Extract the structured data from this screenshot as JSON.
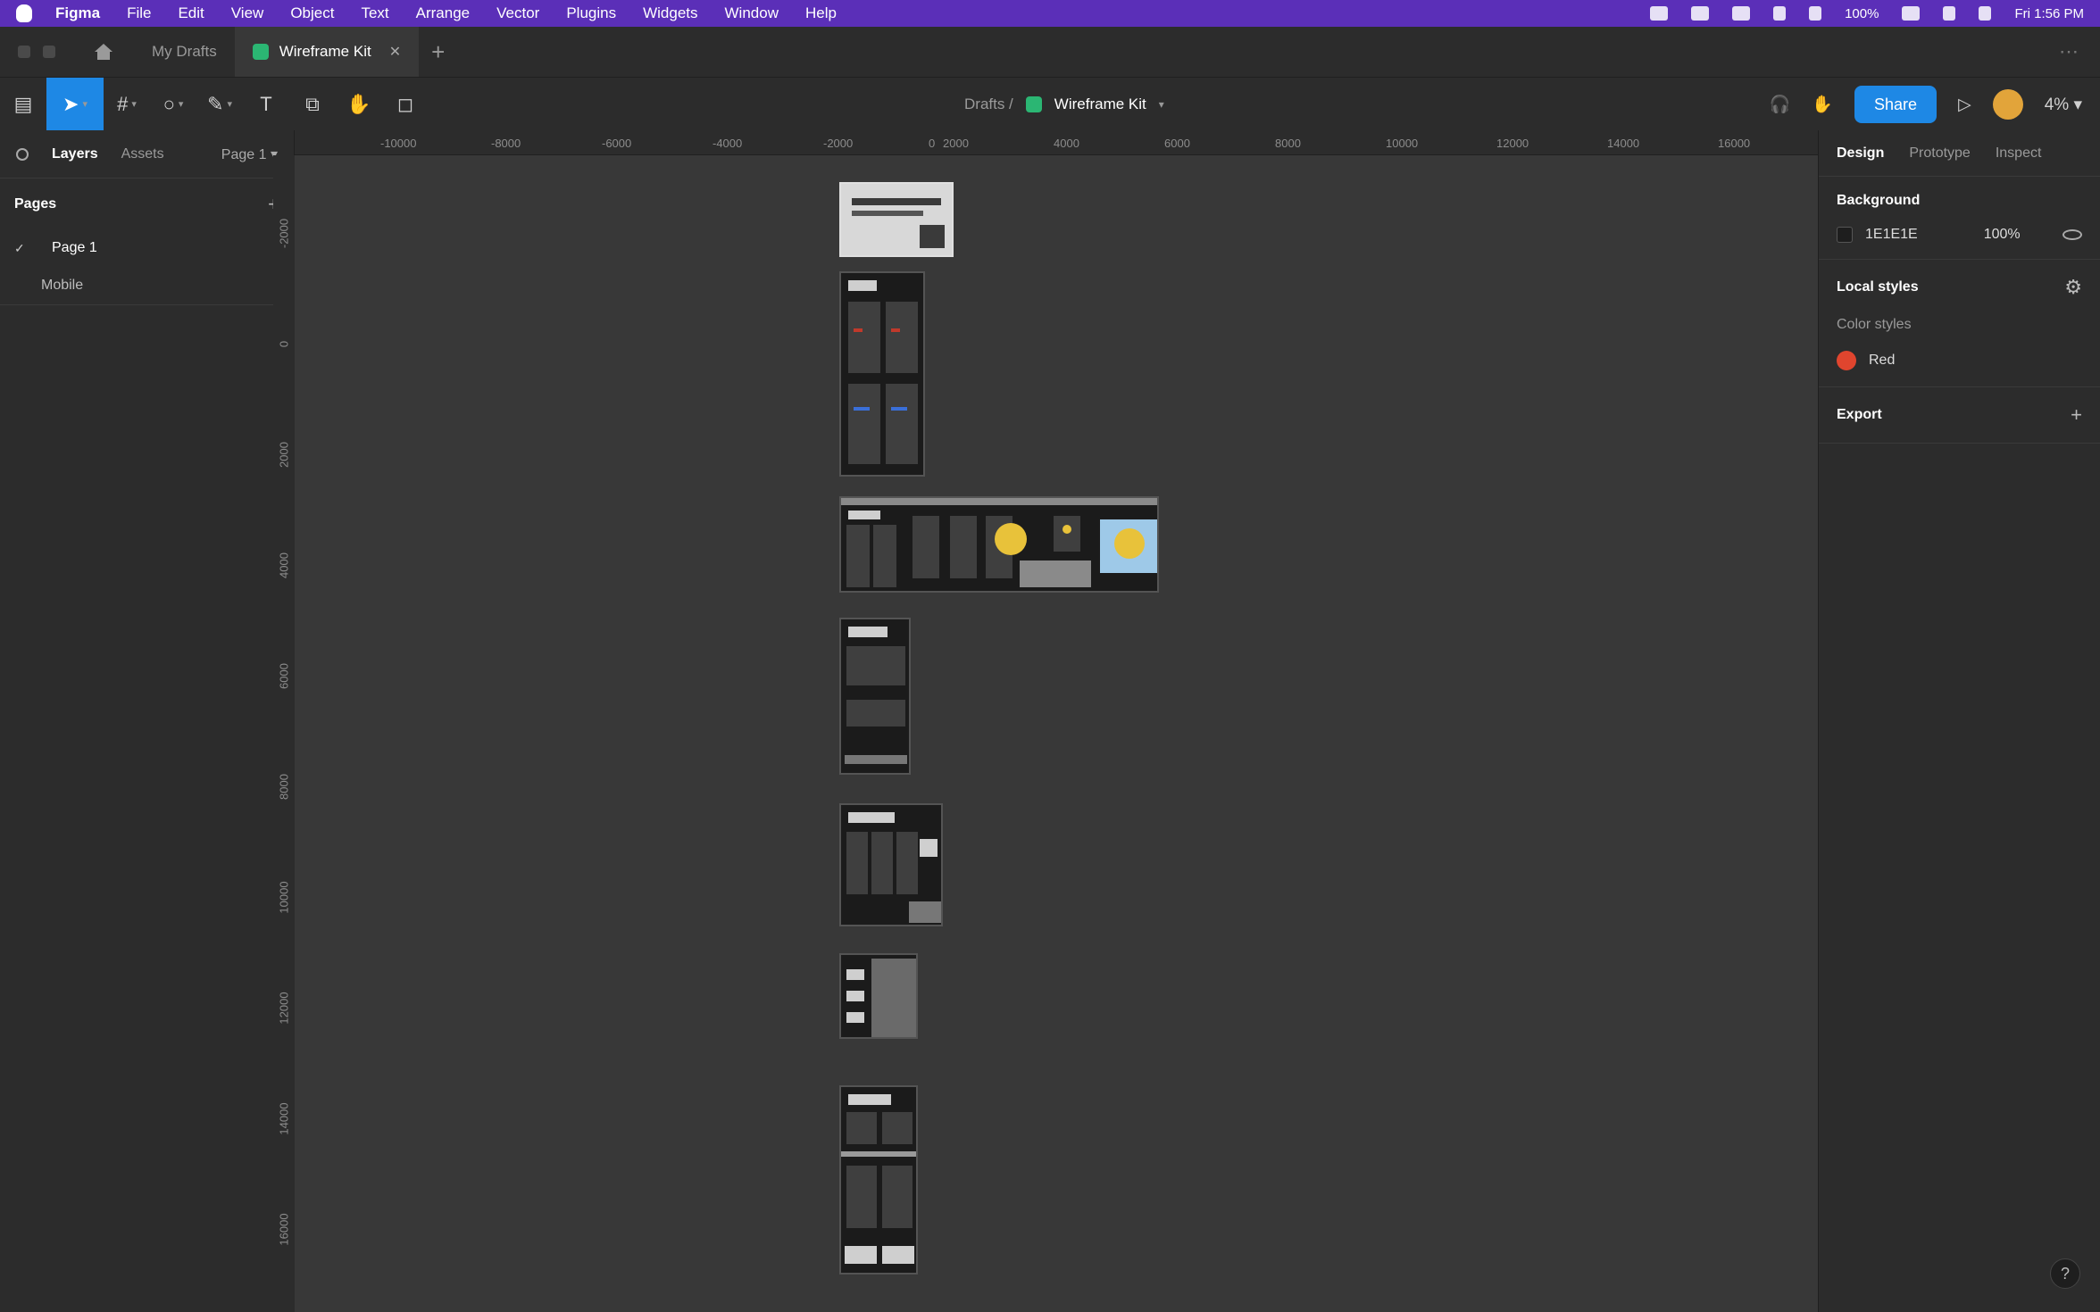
{
  "menubar": {
    "items": [
      "Figma",
      "File",
      "Edit",
      "View",
      "Object",
      "Text",
      "Arrange",
      "Vector",
      "Plugins",
      "Widgets",
      "Window",
      "Help"
    ],
    "battery": "100%",
    "clock": "Fri 1:56 PM"
  },
  "tabs": {
    "drafts_tab": "My Drafts",
    "active_tab": "Wireframe Kit",
    "active_tab_color": "#2bb673"
  },
  "toolbar": {
    "breadcrumb": "Drafts /",
    "file_name": "Wireframe Kit",
    "share_label": "Share",
    "zoom": "4%",
    "accent": "#1e88e5"
  },
  "left_panel": {
    "tab_layers": "Layers",
    "tab_assets": "Assets",
    "page_selector": "Page 1",
    "pages_title": "Pages",
    "pages": [
      "Page 1"
    ],
    "layers": [
      "Mobile"
    ]
  },
  "ruler": {
    "top_ticks": [
      "-10000",
      "-8000",
      "-6000",
      "-4000",
      "-2000",
      "0",
      "2000",
      "4000",
      "6000",
      "8000",
      "10000",
      "12000",
      "14000",
      "16000"
    ],
    "left_ticks": [
      "-2000",
      "0",
      "2000",
      "4000",
      "6000",
      "8000",
      "10000",
      "12000",
      "14000",
      "16000"
    ]
  },
  "right_panel": {
    "tab_design": "Design",
    "tab_prototype": "Prototype",
    "tab_inspect": "Inspect",
    "background_title": "Background",
    "background_hex": "1E1E1E",
    "background_opacity": "100%",
    "local_styles_title": "Local styles",
    "color_styles_label": "Color styles",
    "color_style_name": "Red",
    "color_style_value": "#e0452e",
    "export_title": "Export"
  }
}
